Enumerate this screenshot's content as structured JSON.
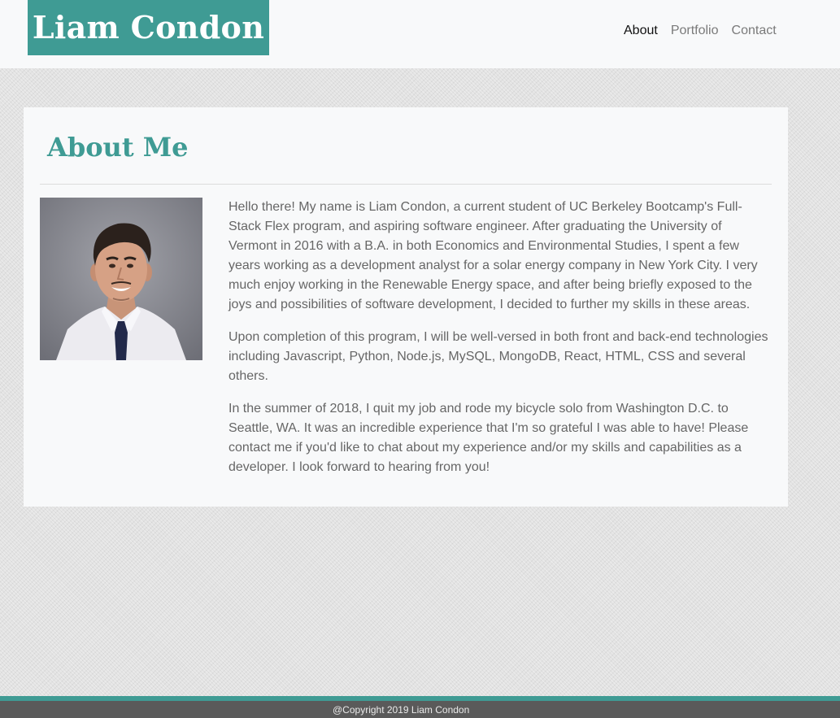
{
  "header": {
    "brand": "Liam Condon",
    "nav": [
      {
        "label": "About",
        "active": true
      },
      {
        "label": "Portfolio",
        "active": false
      },
      {
        "label": "Contact",
        "active": false
      }
    ]
  },
  "about": {
    "title": "About Me",
    "paragraphs": [
      "Hello there! My name is Liam Condon, a current student of UC Berkeley Bootcamp's Full-Stack Flex program, and aspiring software engineer. After graduating the University of Vermont in 2016 with a B.A. in both Economics and Environmental Studies, I spent a few years working as a development analyst for a solar energy company in New York City. I very much enjoy working in the Renewable Energy space, and after being briefly exposed to the joys and possibilities of software development, I decided to further my skills in these areas.",
      "Upon completion of this program, I will be well-versed in both front and back-end technologies including Javascript, Python, Node.js, MySQL, MongoDB, React, HTML, CSS and several others.",
      "In the summer of 2018, I quit my job and rode my bicycle solo from Washington D.C. to Seattle, WA. It was an incredible experience that I'm so grateful I was able to have! Please contact me if you'd like to chat about my experience and/or my skills and capabilities as a developer. I look forward to hearing from you!"
    ]
  },
  "footer": {
    "text": "@Copyright 2019 Liam Condon"
  },
  "colors": {
    "accent": "#3f9b94",
    "footer_bg": "#5a5a5a"
  }
}
